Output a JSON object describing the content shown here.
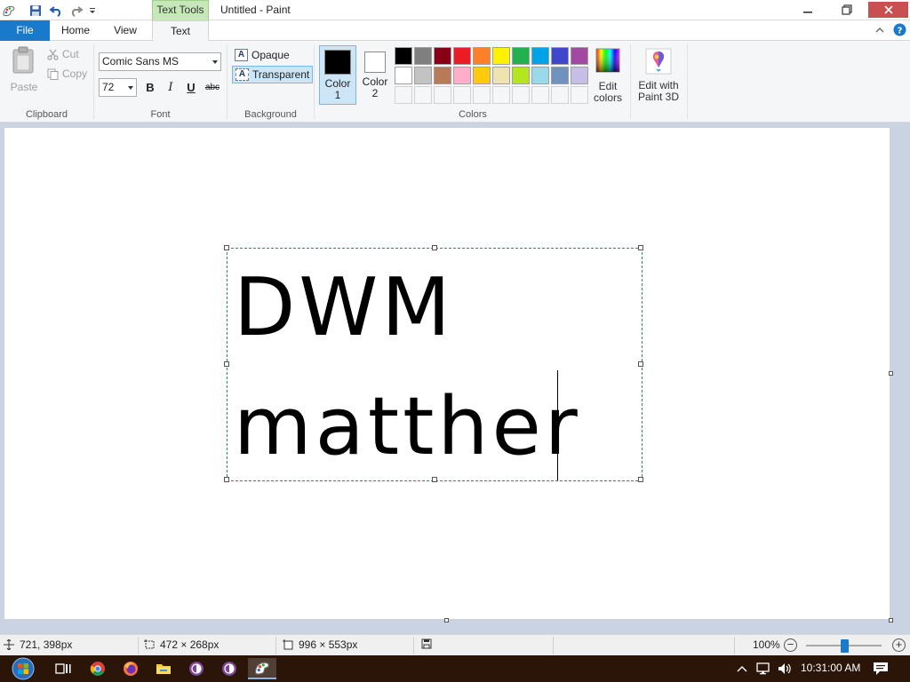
{
  "window": {
    "title": "Untitled - Paint",
    "contextual_tab": "Text Tools"
  },
  "tabs": {
    "file": "File",
    "home": "Home",
    "view": "View",
    "text": "Text"
  },
  "clipboard": {
    "paste": "Paste",
    "cut": "Cut",
    "copy": "Copy",
    "label": "Clipboard"
  },
  "font": {
    "family": "Comic Sans MS",
    "size": "72",
    "bold": "B",
    "italic": "I",
    "underline": "U",
    "strikethrough": "abc",
    "label": "Font"
  },
  "background": {
    "opaque": "Opaque",
    "transparent": "Transparent",
    "selected": "Transparent",
    "label": "Background"
  },
  "colors": {
    "color1_label_a": "Color",
    "color1_label_b": "1",
    "color2_label_a": "Color",
    "color2_label_b": "2",
    "color1": "#000000",
    "color2": "#ffffff",
    "label": "Colors",
    "edit_colors_a": "Edit",
    "edit_colors_b": "colors",
    "paint3d_a": "Edit with",
    "paint3d_b": "Paint 3D",
    "palette": [
      "#000000",
      "#7f7f7f",
      "#880015",
      "#ed1c24",
      "#ff7f27",
      "#fff200",
      "#22b14c",
      "#00a2e8",
      "#3f48cc",
      "#a349a4",
      "#ffffff",
      "#c3c3c3",
      "#b97a57",
      "#ffaec9",
      "#ffc90e",
      "#efe4b0",
      "#b5e61d",
      "#99d9ea",
      "#7092be",
      "#c8bfe7"
    ]
  },
  "canvas": {
    "line1": "DWM",
    "line2": "matther"
  },
  "status": {
    "cursor": "721, 398px",
    "selection": "472 × 268px",
    "canvas_size": "996 × 553px",
    "zoom": "100%"
  },
  "taskbar": {
    "clock": "10:31:00 AM"
  }
}
